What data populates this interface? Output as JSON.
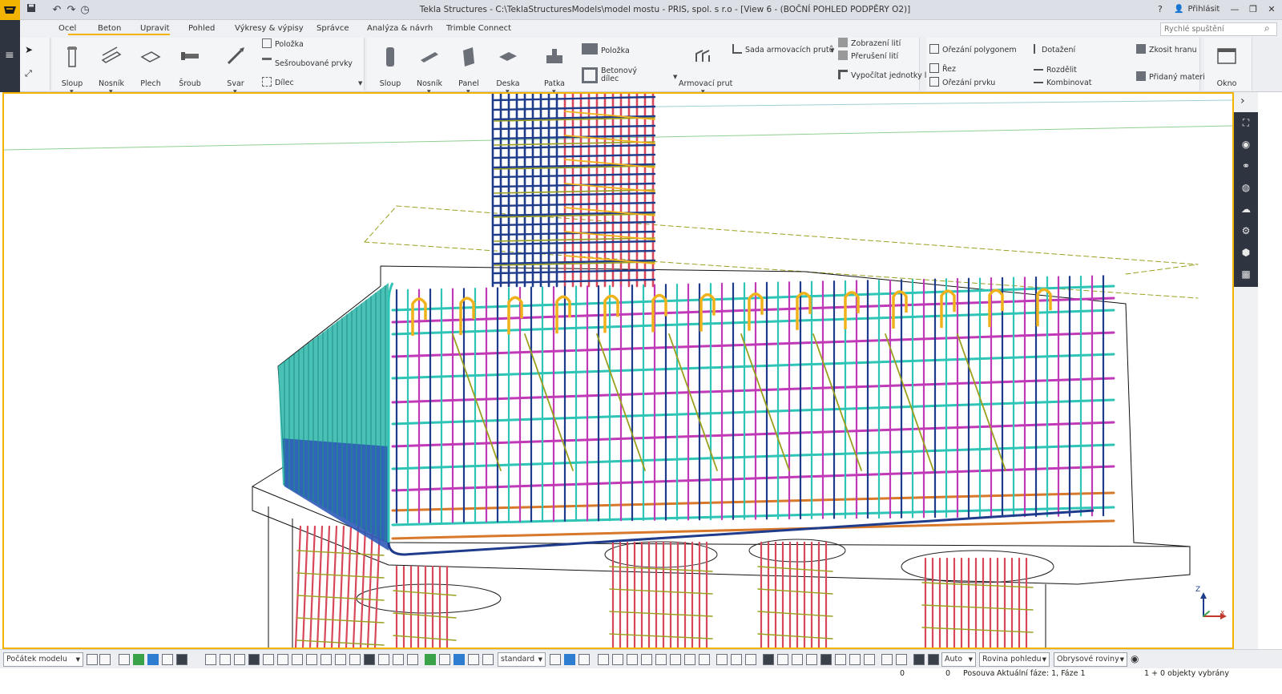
{
  "window": {
    "title": "Tekla Structures - C:\\TeklaStructuresModels\\model mostu - PRIS, spol. s r.o  - [View 6 - (BOČNÍ POHLED PODPĚRY O2)]",
    "login_label": "Přihlásit",
    "help": "?"
  },
  "tabs": [
    "Ocel",
    "Beton",
    "Upravit",
    "Pohled",
    "Výkresy & výpisy",
    "Správce",
    "Analýza & návrh",
    "Trimble Connect"
  ],
  "quick_search": {
    "placeholder": "Rychlé spuštění"
  },
  "ribbon": {
    "steel": {
      "column": "Sloup",
      "beam": "Nosník",
      "plate": "Plech",
      "bolt": "Šroub",
      "weld": "Svar",
      "item": "Položka",
      "bolted_items": "Sešroubované prvky",
      "part": "Dílec"
    },
    "concrete": {
      "column": "Sloup",
      "beam": "Nosník",
      "panel": "Panel",
      "slab": "Deska",
      "footing": "Patka",
      "item": "Položka",
      "concrete_part_1": "Betonový",
      "concrete_part_2": "dílec",
      "rebar": "Armovací prut",
      "rebar_set": "Sada armovacích prutů",
      "pour_display": "Zobrazení lití",
      "pour_break": "Přerušení lití",
      "calc_pour": "Vypočítat jednotky lití"
    },
    "edit": {
      "polygon_cut": "Ořezání polygonem",
      "cut": "Řez",
      "part_cut": "Ořezání prvku",
      "fit": "Dotažení",
      "split": "Rozdělit",
      "combine": "Kombinovat",
      "chamfer": "Zkosit hranu",
      "added_material": "Přidaný materi"
    },
    "window": "Okno"
  },
  "bottom": {
    "work_plane": "Počátek modelu",
    "filter": "standard",
    "snap": "Auto",
    "view_plane": "Rovina pohledu",
    "outline_planes": "Obrysové roviny"
  },
  "status": {
    "x": "0",
    "y": "0",
    "command": "Posouva",
    "phase": "Aktuální fáze: 1, Fáze 1",
    "selected": "1 + 0 objekty vybrány"
  },
  "axes": {
    "z": "Z",
    "x": "x"
  },
  "icons": [
    "tekla-logo",
    "save-icon",
    "undo-icon",
    "redo-icon",
    "history-icon",
    "user-icon",
    "minimize-icon",
    "restore-icon",
    "close-icon",
    "menu-icon",
    "select-arrow-icon",
    "eye-icon",
    "settings-icon",
    "cloud-icon",
    "cube-icon"
  ],
  "colors": {
    "accent": "#f2b400",
    "rebar_cyan": "#2ec4b6",
    "rebar_magenta": "#c03ab8",
    "rebar_yellow": "#f0b21a",
    "rebar_red": "#d9475a",
    "rebar_navy": "#1f3c8c",
    "rebar_olive": "#9aa01e",
    "rebar_orange": "#d7782a"
  }
}
